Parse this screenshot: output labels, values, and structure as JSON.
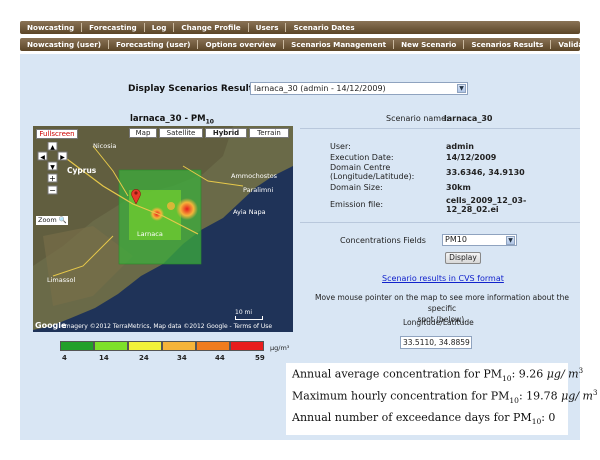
{
  "nav_main": [
    "Nowcasting",
    "Forecasting",
    "Log",
    "Change Profile",
    "Users",
    "Scenario Dates"
  ],
  "nav_sub": [
    "Nowcasting (user)",
    "Forecasting (user)",
    "Options overview",
    "Scenarios Management",
    "New Scenario",
    "Scenarios Results",
    "Validation"
  ],
  "display": {
    "label": "Display Scenarios Results:",
    "selected": "larnaca_30 (admin - 14/12/2009)"
  },
  "map": {
    "title": "larnaca_30 - PM",
    "title_sub": "10",
    "fullscreen": "Fullscreen",
    "types": [
      "Map",
      "Satellite",
      "Hybrid",
      "Terrain"
    ],
    "zoom_label": "Zoom",
    "labels": {
      "nicosia": "Nicosia",
      "cyprus": "Cyprus",
      "larnaca": "Larnaca",
      "famagusta": "Ammochostos",
      "paralimni": "Paralimni",
      "agia_napa": "Ayia Napa",
      "limassol": "Limassol"
    },
    "scale": "10 mi",
    "credit": "Imagery ©2012 TerraMetrics, Map data ©2012 Google - Terms of Use"
  },
  "legend": {
    "ticks": [
      "4",
      "14",
      "24",
      "34",
      "44",
      "59"
    ],
    "unit": "µg/m³",
    "colors": [
      "#22a02a",
      "#7ee02a",
      "#f2f23a",
      "#f5b43a",
      "#f07c1e",
      "#e81c1c"
    ]
  },
  "scenario": {
    "name_label": "Scenario name:",
    "name_value": "larnaca_30",
    "user_label": "User:",
    "user_value": "admin",
    "date_label": "Execution Date:",
    "date_value": "14/12/2009",
    "centre_label1": "Domain Centre",
    "centre_label2": "(Longitude/Latitude):",
    "centre_value": "33.6346, 34.9130",
    "size_label": "Domain Size:",
    "size_value": "30km",
    "emission_label": "Emission file:",
    "emission_value1": "cells_2009_12_03-",
    "emission_value2": "12_28_02.ei"
  },
  "fields": {
    "label": "Concentrations Fields",
    "selected": "PM10",
    "button": "Display"
  },
  "link": "Scenario results in CVS format",
  "help1": "Move mouse pointer on the map to see more information about the specific",
  "help2": "spot (below).",
  "coord_label": "Longitude/Latitude",
  "coord_value": "33.5110, 34.8859",
  "overlay": {
    "l1_pre": "Annual average concentration for PM",
    "l1_sub": "10",
    "l1_post": ": 9.26 ",
    "l1_unit": "μg/ m",
    "l1_sup": "3",
    "l2_pre": "Maximum hourly concentration for PM",
    "l2_sub": "10",
    "l2_post": ": 19.78 ",
    "l2_unit": "μg/ m",
    "l2_sup": "3",
    "l3_pre": "Annual number of exceedance days for PM",
    "l3_sub": "10",
    "l3_post": ": 0"
  }
}
